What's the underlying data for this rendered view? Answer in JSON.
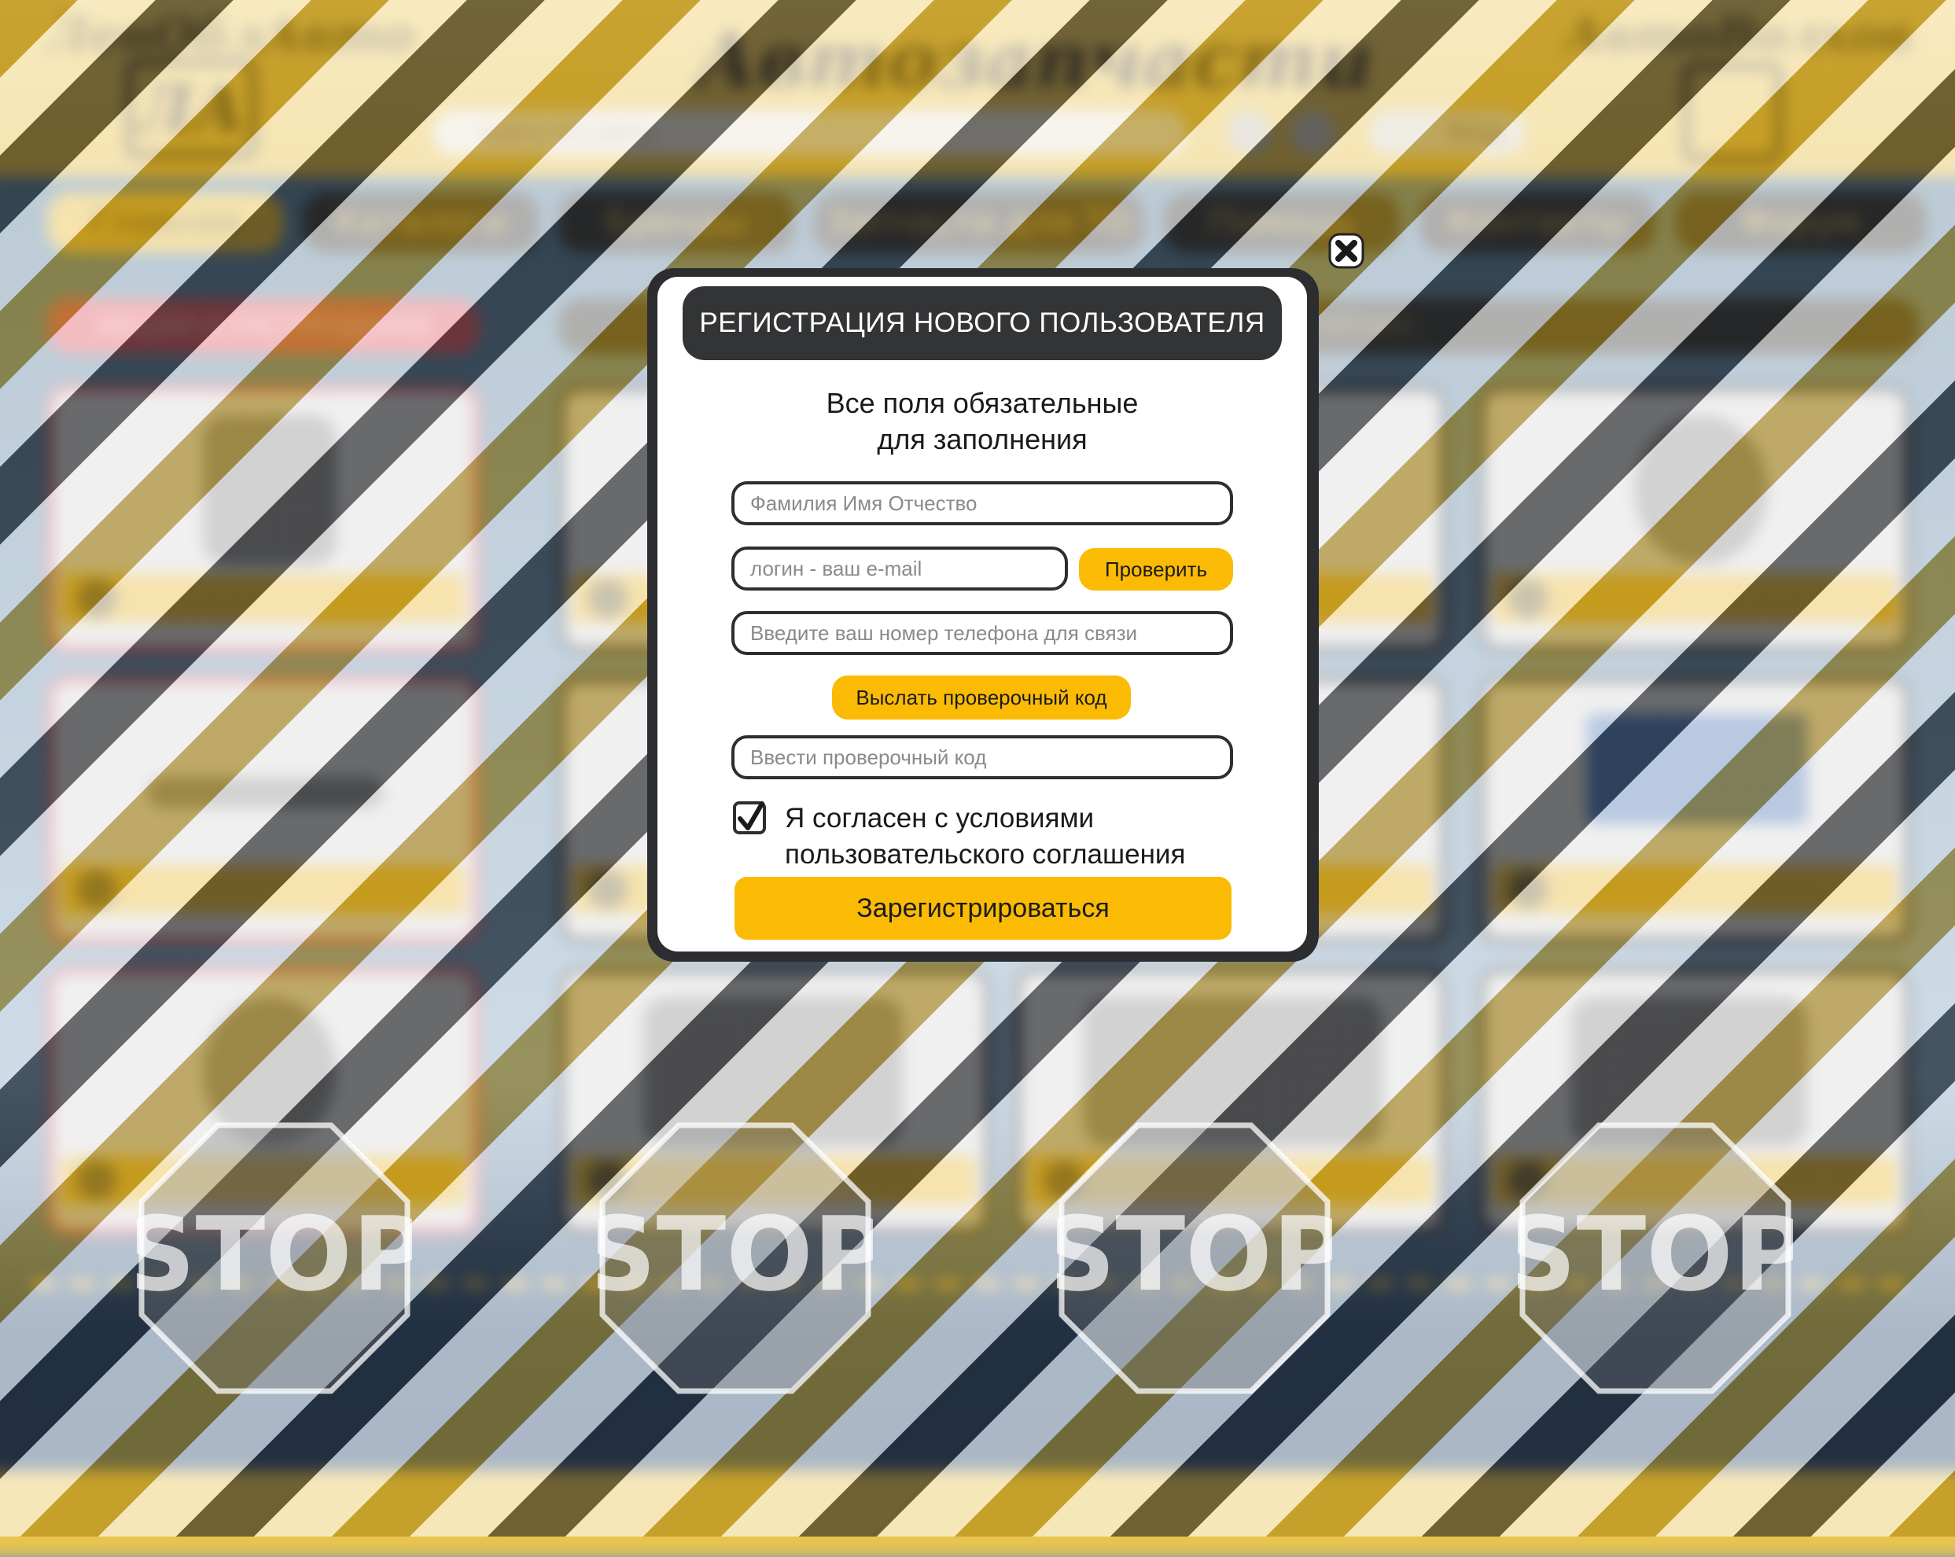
{
  "background_page": {
    "brand_left": "ЛенОблАвто",
    "logo_left": "ЛА",
    "site_title": "Автозапчасти",
    "brand_right": "АвтоВолхов",
    "search_placeholder": "поиск по сайту",
    "login_label": "Вход",
    "nav": [
      "Главная",
      "Каталоги",
      "Бренды",
      "Запчасти для ТО",
      "Помощь",
      "Контакты",
      "Форум"
    ],
    "section_sale": "АКЦИИ И РАСПРОДАЖИ",
    "section_popular": "НАИБОЛЕЕ ПОПУЛЯРНЫЕ"
  },
  "modal": {
    "title": "РЕГИСТРАЦИЯ НОВОГО ПОЛЬЗОВАТЕЛЯ",
    "subtitle_line1": "Все поля обязательные",
    "subtitle_line2": "для заполнения",
    "fio_placeholder": "Фамилия Имя Отчество",
    "email_placeholder": "логин - ваш e-mail",
    "check_button": "Проверить",
    "phone_placeholder": "Введите ваш номер телефона для связи",
    "send_code_button": "Выслать проверочный код",
    "code_placeholder": "Ввести проверочный код",
    "agree_checked": true,
    "agree_line1": "Я согласен с условиями",
    "agree_line2": "пользовательского соглашения",
    "register_button": "Зарегистрироваться"
  },
  "stop_sign_text": "STOP",
  "colors": {
    "accent_yellow": "#fbbb05",
    "dark": "#2c2d31",
    "stripe_gold": "#a8820c",
    "stripe_black": "#181a1e"
  }
}
